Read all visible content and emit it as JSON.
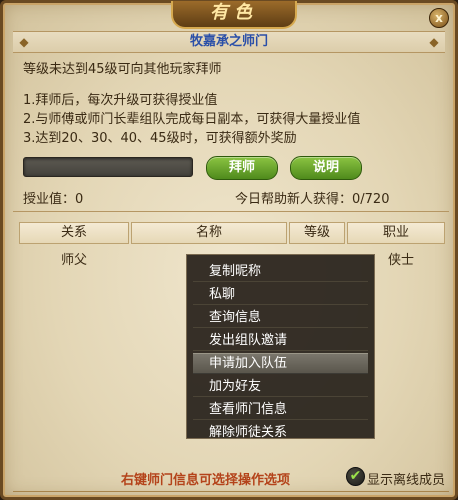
{
  "window": {
    "title_art": "有色",
    "close_glyph": "x"
  },
  "subtitle": "牧嘉承之师门",
  "info": {
    "level_notice": "等级未达到45级可向其他玩家拜师",
    "rules": [
      "1.拜师后，每次升级可获得授业值",
      "2.与师傅或师门长辈组队完成每日副本，可获得大量授业值",
      "3.达到20、30、40、45级时，可获得额外奖励"
    ]
  },
  "actions": {
    "name_input_value": "",
    "apprentice_button": "拜师",
    "explain_button": "说明"
  },
  "stats": {
    "teaching_points": "授业值：0",
    "daily_help": "今日帮助新人获得：0/720"
  },
  "table": {
    "headers": [
      "关系",
      "名称",
      "等级",
      "职业"
    ],
    "rows": [
      {
        "relation": "师父",
        "name": "",
        "level": "",
        "class": "侠士"
      }
    ]
  },
  "context_menu": {
    "items": [
      "复制昵称",
      "私聊",
      "查询信息",
      "发出组队邀请",
      "申请加入队伍",
      "加为好友",
      "查看师门信息",
      "解除师徒关系"
    ],
    "hovered_index": 4
  },
  "footer": {
    "hint": "右键师门信息可选择操作选项",
    "show_offline_label": "显示离线成员",
    "show_offline_checked": true
  },
  "colors": {
    "subtitle": "#2a4fa8",
    "hint": "#b4431a",
    "button_green": "#6aa82c"
  },
  "icons": {
    "close": "close-icon",
    "checkbox": "checkmark-icon",
    "ornament": "diamond-ornament-icon"
  }
}
